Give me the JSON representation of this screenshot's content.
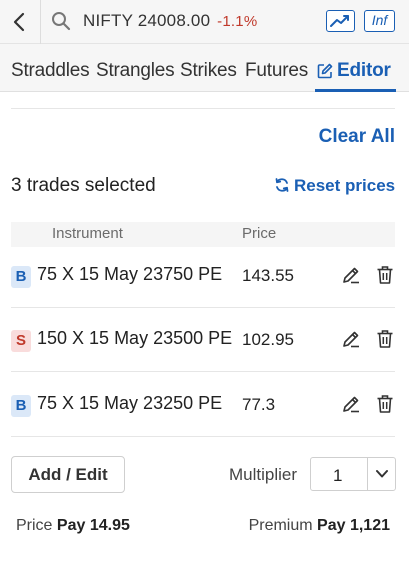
{
  "header": {
    "symbol": "NIFTY 24008.00",
    "change": "-1.1%",
    "inf_label": "Inf"
  },
  "tabs": [
    {
      "label": "Straddles"
    },
    {
      "label": "Strangles"
    },
    {
      "label": "Strikes"
    },
    {
      "label": "Futures"
    },
    {
      "label": "Editor"
    }
  ],
  "editor": {
    "clear_all": "Clear All",
    "trades_selected": "3 trades selected",
    "reset_prices": "Reset prices",
    "columns": {
      "instrument": "Instrument",
      "price": "Price"
    },
    "trades": [
      {
        "side": "B",
        "instrument": "75 X 15 May 23750 PE",
        "price": "143.55"
      },
      {
        "side": "S",
        "instrument": "150 X 15 May 23500 PE",
        "price": "102.95"
      },
      {
        "side": "B",
        "instrument": "75 X 15 May 23250 PE",
        "price": "77.3"
      }
    ],
    "add_edit": "Add / Edit",
    "multiplier_label": "Multiplier",
    "multiplier_value": "1",
    "summary": {
      "price_label": "Price",
      "price_value": "Pay 14.95",
      "premium_label": "Premium",
      "premium_value": "Pay 1,121"
    }
  },
  "colors": {
    "accent": "#1a5fb4",
    "negative": "#c0392b",
    "buy_badge_bg": "#dbe8f8",
    "sell_badge_bg": "#f9dcdc"
  }
}
